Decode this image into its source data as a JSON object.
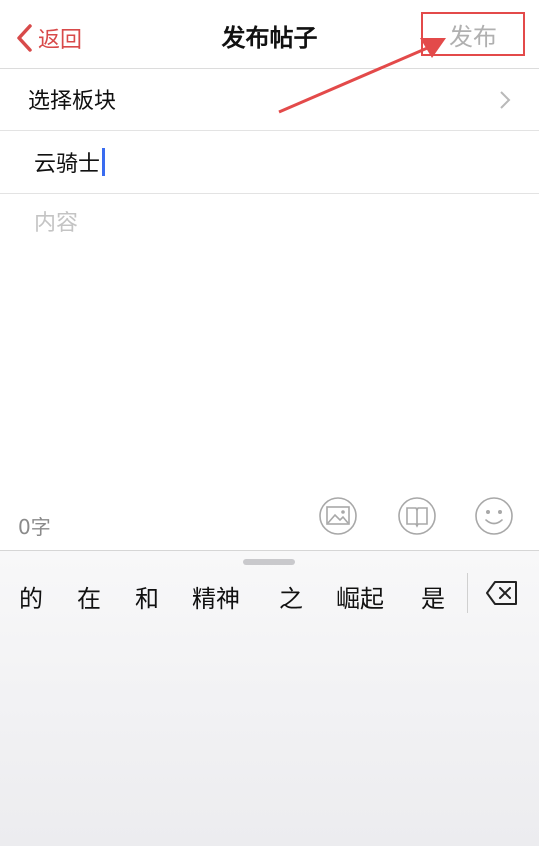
{
  "nav": {
    "back_label": "返回",
    "title": "发布帖子",
    "publish_label": "发布"
  },
  "form": {
    "section_label": "选择板块",
    "title_value": "云骑士",
    "content_placeholder": "内容",
    "word_count": "0字"
  },
  "toolbar": {
    "icons": [
      "image-icon",
      "book-icon",
      "emoji-icon"
    ]
  },
  "keyboard": {
    "candidates": [
      "的",
      "在",
      "和",
      "精神",
      "之",
      "崛起",
      "是"
    ]
  },
  "colors": {
    "accent": "#d84a4a",
    "annotation": "#e34a4a",
    "caret": "#3a6cf0"
  }
}
